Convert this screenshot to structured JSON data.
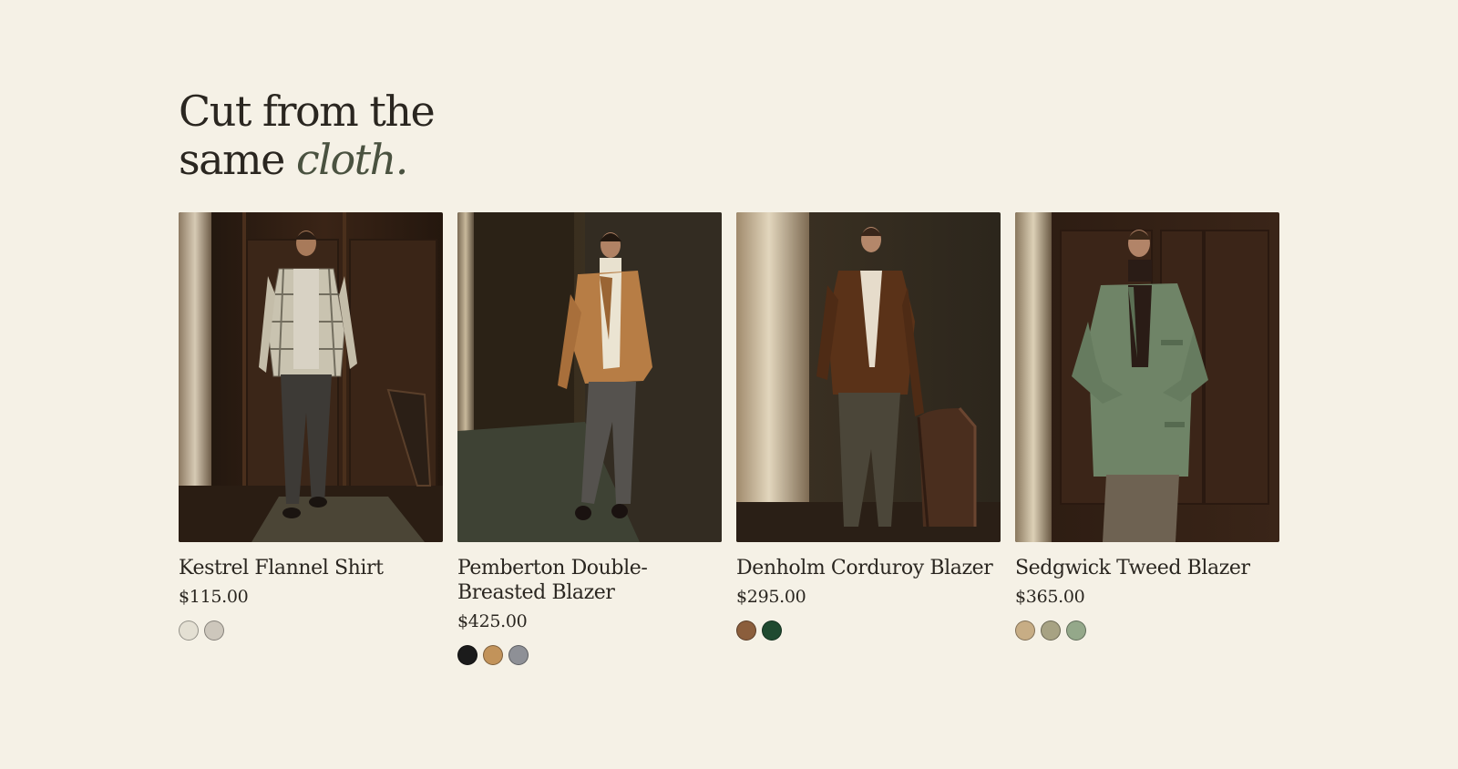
{
  "section": {
    "headline_line1": "Cut from the",
    "headline_line2_plain": "same",
    "headline_line2_italic": "cloth."
  },
  "products": [
    {
      "name": "Kestrel Flannel Shirt",
      "price": "$115.00",
      "image_alt": "Man walking in a wood-paneled room wearing a plaid flannel overshirt, grey tee and grey trousers",
      "swatches": [
        {
          "color": "#e4e0d3",
          "label": "ecru"
        },
        {
          "color": "#cdc7bc",
          "label": "stone"
        }
      ]
    },
    {
      "name": "Pemberton Double-Breasted Blazer",
      "price": "$425.00",
      "image_alt": "Man leaning against a dark wall wearing a camel blazer, cream turtleneck and grey trousers",
      "swatches": [
        {
          "color": "#1b1b1b",
          "label": "black"
        },
        {
          "color": "#c2935a",
          "label": "camel"
        },
        {
          "color": "#8e9096",
          "label": "grey"
        }
      ]
    },
    {
      "name": "Denholm Corduroy Blazer",
      "price": "$295.00",
      "image_alt": "Man standing beside a leather chair in a brown corduroy blazer and olive trousers",
      "swatches": [
        {
          "color": "#8b5e3c",
          "label": "brown"
        },
        {
          "color": "#1f4a30",
          "label": "forest green"
        }
      ]
    },
    {
      "name": "Sedgwick Tweed Blazer",
      "price": "$365.00",
      "image_alt": "Man buttoning a sage green tweed blazer over a dark turtleneck",
      "swatches": [
        {
          "color": "#c7ad85",
          "label": "sand"
        },
        {
          "color": "#a7a283",
          "label": "olive"
        },
        {
          "color": "#94a88a",
          "label": "sage"
        }
      ]
    }
  ]
}
